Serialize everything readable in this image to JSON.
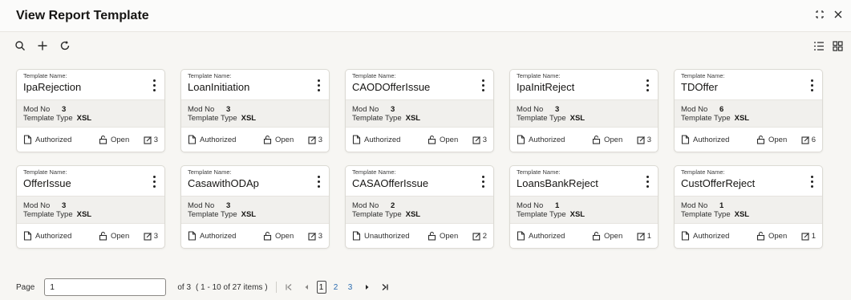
{
  "header": {
    "title": "View Report Template"
  },
  "cards": [
    {
      "label": "Template Name:",
      "name": "IpaRejection",
      "mod_label": "Mod No",
      "mod": "3",
      "type_label": "Template Type",
      "type": "XSL",
      "status": "Authorized",
      "lock": "Open",
      "count": "3"
    },
    {
      "label": "Template Name:",
      "name": "LoanInitiation",
      "mod_label": "Mod No",
      "mod": "3",
      "type_label": "Template Type",
      "type": "XSL",
      "status": "Authorized",
      "lock": "Open",
      "count": "3"
    },
    {
      "label": "Template Name:",
      "name": "CAODOfferIssue",
      "mod_label": "Mod No",
      "mod": "3",
      "type_label": "Template Type",
      "type": "XSL",
      "status": "Authorized",
      "lock": "Open",
      "count": "3"
    },
    {
      "label": "Template Name:",
      "name": "IpaInitReject",
      "mod_label": "Mod No",
      "mod": "3",
      "type_label": "Template Type",
      "type": "XSL",
      "status": "Authorized",
      "lock": "Open",
      "count": "3"
    },
    {
      "label": "Template Name:",
      "name": "TDOffer",
      "mod_label": "Mod No",
      "mod": "6",
      "type_label": "Template Type",
      "type": "XSL",
      "status": "Authorized",
      "lock": "Open",
      "count": "6"
    },
    {
      "label": "Template Name:",
      "name": "OfferIssue",
      "mod_label": "Mod No",
      "mod": "3",
      "type_label": "Template Type",
      "type": "XSL",
      "status": "Authorized",
      "lock": "Open",
      "count": "3"
    },
    {
      "label": "Template Name:",
      "name": "CasawithODAp",
      "mod_label": "Mod No",
      "mod": "3",
      "type_label": "Template Type",
      "type": "XSL",
      "status": "Authorized",
      "lock": "Open",
      "count": "3"
    },
    {
      "label": "Template Name:",
      "name": "CASAOfferIssue",
      "mod_label": "Mod No",
      "mod": "2",
      "type_label": "Template Type",
      "type": "XSL",
      "status": "Unauthorized",
      "lock": "Open",
      "count": "2"
    },
    {
      "label": "Template Name:",
      "name": "LoansBankReject",
      "mod_label": "Mod No",
      "mod": "1",
      "type_label": "Template Type",
      "type": "XSL",
      "status": "Authorized",
      "lock": "Open",
      "count": "1"
    },
    {
      "label": "Template Name:",
      "name": "CustOfferReject",
      "mod_label": "Mod No",
      "mod": "1",
      "type_label": "Template Type",
      "type": "XSL",
      "status": "Authorized",
      "lock": "Open",
      "count": "1"
    }
  ],
  "pagination": {
    "page_label": "Page",
    "page_value": "1",
    "of_text": "of 3",
    "items_text": "( 1 - 10 of 27 items )",
    "pages": [
      "1",
      "2",
      "3"
    ],
    "current": "1"
  }
}
